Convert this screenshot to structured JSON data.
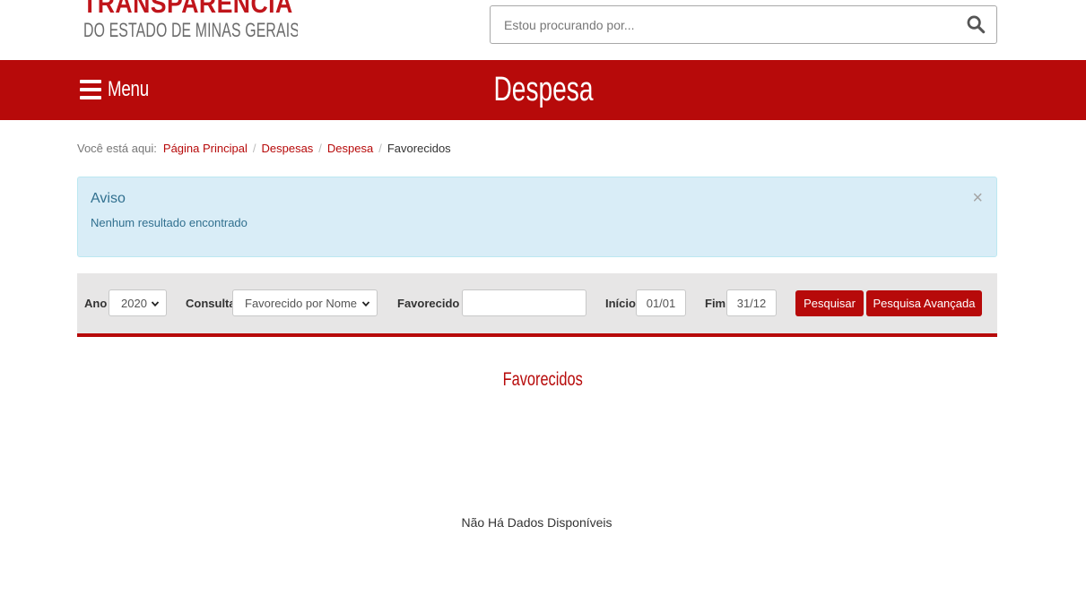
{
  "header": {
    "logo_main": "TRANSPARÊNCIA",
    "logo_sub": "DO ESTADO DE MINAS GERAIS",
    "search_placeholder": "Estou procurando por..."
  },
  "navbar": {
    "menu_label": "Menu",
    "page_title": "Despesa"
  },
  "breadcrumb": {
    "lead": "Você está aqui:",
    "items": [
      "Página Principal",
      "Despesas",
      "Despesa"
    ],
    "current": "Favorecidos"
  },
  "alert": {
    "title": "Aviso",
    "message": "Nenhum resultado encontrado",
    "close_symbol": "×"
  },
  "filters": {
    "ano_label": "Ano",
    "ano_value": "2020",
    "consulta_label": "Consulta",
    "consulta_value": "Favorecido por Nome",
    "favorecido_label": "Favorecido",
    "required_mark": "*",
    "favorecido_value": "",
    "inicio_label": "Início",
    "inicio_value": "01/01",
    "fim_label": "Fim",
    "fim_value": "31/12",
    "search_button": "Pesquisar",
    "advanced_button": "Pesquisa Avançada"
  },
  "results": {
    "title": "Favorecidos",
    "empty_message": "Não Há Dados Disponíveis"
  },
  "colors": {
    "brand_red": "#b70a0a",
    "alert_bg": "#d9edf7",
    "alert_text": "#31708f",
    "filter_bg": "#e7e6e6"
  },
  "icons": {
    "search": "search-icon",
    "menu": "hamburger-menu-icon",
    "select": "chevron-down-icon"
  }
}
